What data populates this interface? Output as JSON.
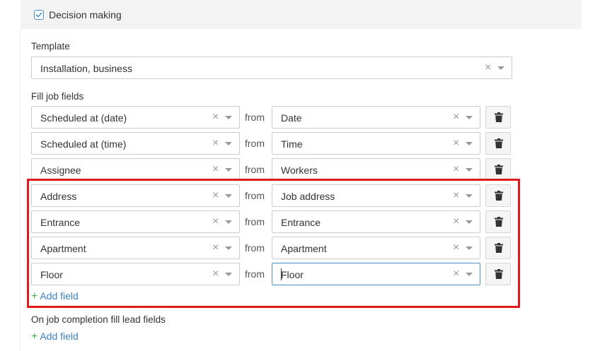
{
  "section": {
    "title": "Decision making",
    "checked": true
  },
  "template": {
    "label": "Template",
    "value": "Installation, business",
    "clear_glyph": "×"
  },
  "fill_job_fields": {
    "label": "Fill job fields",
    "from_word": "from",
    "rows": [
      {
        "target": "Scheduled at (date)",
        "source": "Date"
      },
      {
        "target": "Scheduled at (time)",
        "source": "Time"
      },
      {
        "target": "Assignee",
        "source": "Workers"
      },
      {
        "target": "Address",
        "source": "Job address"
      },
      {
        "target": "Entrance",
        "source": "Entrance"
      },
      {
        "target": "Apartment",
        "source": "Apartment"
      },
      {
        "target": "Floor",
        "source": "Floor"
      }
    ],
    "add_field": "Add field"
  },
  "completion": {
    "label": "On job completion fill lead fields",
    "add_field": "Add field"
  },
  "icons": {
    "clear": "close-icon",
    "caret": "chevron-down-icon",
    "delete": "trash-icon",
    "add": "plus-icon",
    "checkbox": "check-icon"
  },
  "colors": {
    "accent": "#4a90c8",
    "link": "#3a7fbf",
    "plus": "#4caf50",
    "highlight": "#e0191e"
  }
}
